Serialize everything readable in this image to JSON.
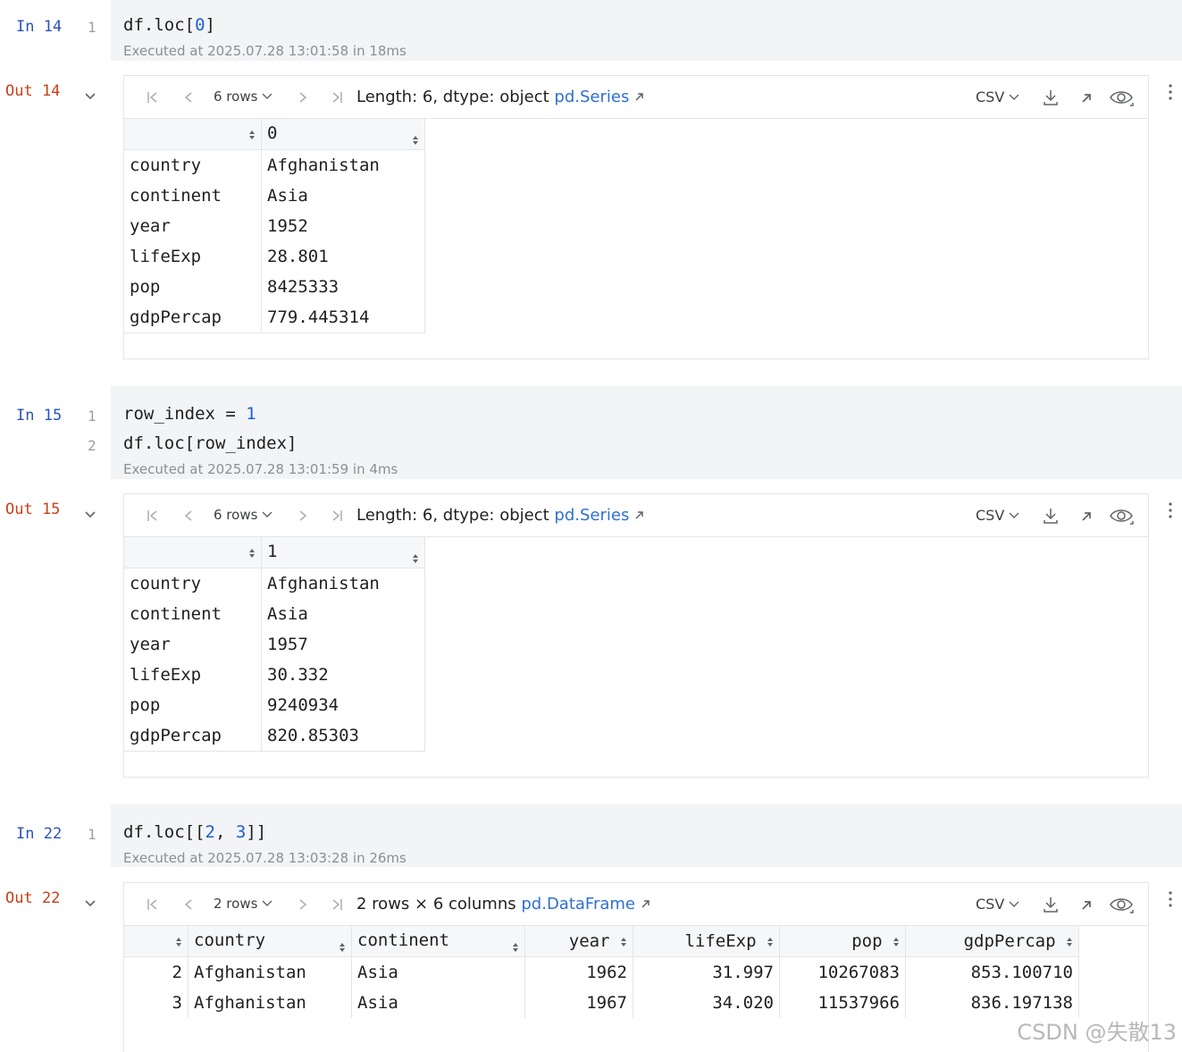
{
  "cells": [
    {
      "in_label": "In 14",
      "out_label": "Out 14",
      "lines": [
        {
          "no": "1"
        }
      ],
      "code_line1_parts": [
        "df.loc[",
        "0",
        "]"
      ],
      "executed": "Executed at 2025.07.28 13:01:58 in 18ms",
      "rows_label": "6 rows",
      "info": "Length: 6, dtype: object",
      "link": "pd.Series",
      "csv": "CSV",
      "col_header": "0",
      "rows": [
        {
          "k": "country",
          "v": "Afghanistan"
        },
        {
          "k": "continent",
          "v": "Asia"
        },
        {
          "k": "year",
          "v": "1952"
        },
        {
          "k": "lifeExp",
          "v": "28.801"
        },
        {
          "k": "pop",
          "v": "8425333"
        },
        {
          "k": "gdpPercap",
          "v": "779.445314"
        }
      ]
    },
    {
      "in_label": "In 15",
      "out_label": "Out 15",
      "lines": [
        {
          "no": "1"
        },
        {
          "no": "2"
        }
      ],
      "code_line1_parts": [
        "row_index = ",
        "1"
      ],
      "code_line2": "df.loc[row_index]",
      "executed": "Executed at 2025.07.28 13:01:59 in 4ms",
      "rows_label": "6 rows",
      "info": "Length: 6, dtype: object",
      "link": "pd.Series",
      "csv": "CSV",
      "col_header": "1",
      "rows": [
        {
          "k": "country",
          "v": "Afghanistan"
        },
        {
          "k": "continent",
          "v": "Asia"
        },
        {
          "k": "year",
          "v": "1957"
        },
        {
          "k": "lifeExp",
          "v": "30.332"
        },
        {
          "k": "pop",
          "v": "9240934"
        },
        {
          "k": "gdpPercap",
          "v": "820.85303"
        }
      ]
    },
    {
      "in_label": "In 22",
      "out_label": "Out 22",
      "lines": [
        {
          "no": "1"
        }
      ],
      "code_line1_parts": [
        "df.loc[[",
        "2",
        ", ",
        "3",
        "]]"
      ],
      "executed": "Executed at 2025.07.28 13:03:28 in 26ms",
      "rows_label": "2 rows",
      "info": "2 rows × 6 columns",
      "link": "pd.DataFrame",
      "csv": "CSV",
      "columns": [
        "country",
        "continent",
        "year",
        "lifeExp",
        "pop",
        "gdpPercap"
      ],
      "df_rows": [
        {
          "idx": "2",
          "vals": [
            "Afghanistan",
            "Asia",
            "1962",
            "31.997",
            "10267083",
            "853.100710"
          ]
        },
        {
          "idx": "3",
          "vals": [
            "Afghanistan",
            "Asia",
            "1967",
            "34.020",
            "11537966",
            "836.197138"
          ]
        }
      ]
    }
  ],
  "icons": [
    "first-page-icon",
    "prev-page-icon",
    "chevron-down-icon",
    "next-page-icon",
    "last-page-icon",
    "external-link-icon",
    "download-icon",
    "open-in-new-icon",
    "eye-icon",
    "kebab-menu-icon",
    "sort-icon",
    "collapse-chevron-icon"
  ],
  "watermark": "CSDN @失散13",
  "colors": {
    "in_label": "#2a52be",
    "out_label": "#c8401a",
    "link": "#2f6fd6",
    "number": "#1a5fd6"
  }
}
